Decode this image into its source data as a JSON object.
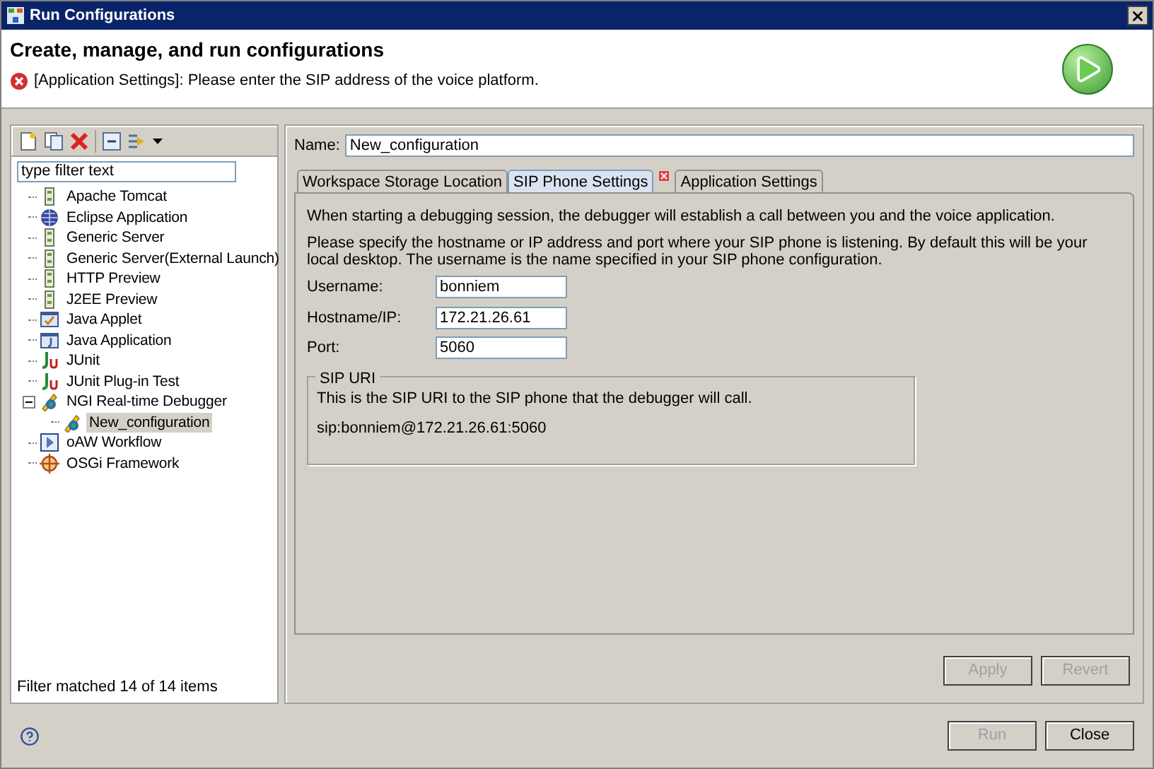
{
  "window": {
    "title": "Run Configurations"
  },
  "header": {
    "title": "Create, manage, and run configurations",
    "message": "[Application Settings]: Please enter the SIP address of the voice platform."
  },
  "filter": {
    "placeholder": "type filter text"
  },
  "tree": [
    {
      "label": "Apache Tomcat",
      "kind": "server",
      "selected": false
    },
    {
      "label": "Eclipse Application",
      "kind": "globe",
      "selected": false
    },
    {
      "label": "Generic Server",
      "kind": "server",
      "selected": false
    },
    {
      "label": "Generic Server(External Launch)",
      "kind": "server",
      "selected": false
    },
    {
      "label": "HTTP Preview",
      "kind": "server",
      "selected": false
    },
    {
      "label": "J2EE Preview",
      "kind": "server",
      "selected": false
    },
    {
      "label": "Java Applet",
      "kind": "applet",
      "selected": false
    },
    {
      "label": "Java Application",
      "kind": "app",
      "selected": false
    },
    {
      "label": "JUnit",
      "kind": "junit",
      "selected": false
    },
    {
      "label": "JUnit Plug-in Test",
      "kind": "junit",
      "selected": false
    },
    {
      "label": "NGI Real-time Debugger",
      "kind": "debugger",
      "selected": false,
      "expanded": true,
      "children": [
        {
          "label": "New_configuration",
          "kind": "debugger",
          "selected": true
        }
      ]
    },
    {
      "label": "oAW Workflow",
      "kind": "workflow",
      "selected": false
    },
    {
      "label": "OSGi Framework",
      "kind": "osgi",
      "selected": false
    }
  ],
  "filter_status": "Filter matched 14 of 14 items",
  "name_label": "Name:",
  "name_value": "New_configuration",
  "tabs": [
    {
      "label": "Workspace Storage Location",
      "selected": false,
      "error": false
    },
    {
      "label": "SIP Phone Settings",
      "selected": true,
      "error": false
    },
    {
      "label": "Application Settings",
      "selected": false,
      "error": true
    }
  ],
  "intro": "When starting a debugging session, the debugger will establish a call between you and the voice application.",
  "help": "Please specify the hostname or IP address and port where your SIP phone is listening.  By default this will be your local desktop.  The username is the name specified in your SIP phone configuration.",
  "fields": [
    {
      "label": "Username:",
      "value": "bonniem"
    },
    {
      "label": "Hostname/IP:",
      "value": "172.21.26.61"
    },
    {
      "label": "Port:",
      "value": "5060"
    }
  ],
  "sip_uri": {
    "title": "SIP URI",
    "description": "This is the SIP URI to the SIP phone that the debugger will call.",
    "value": "sip:bonniem@172.21.26.61:5060"
  },
  "panel_buttons": [
    {
      "label": "Apply",
      "disabled": true
    },
    {
      "label": "Revert",
      "disabled": true
    }
  ],
  "dialog_buttons": [
    {
      "label": "Run",
      "disabled": true
    },
    {
      "label": "Close",
      "disabled": false
    }
  ]
}
